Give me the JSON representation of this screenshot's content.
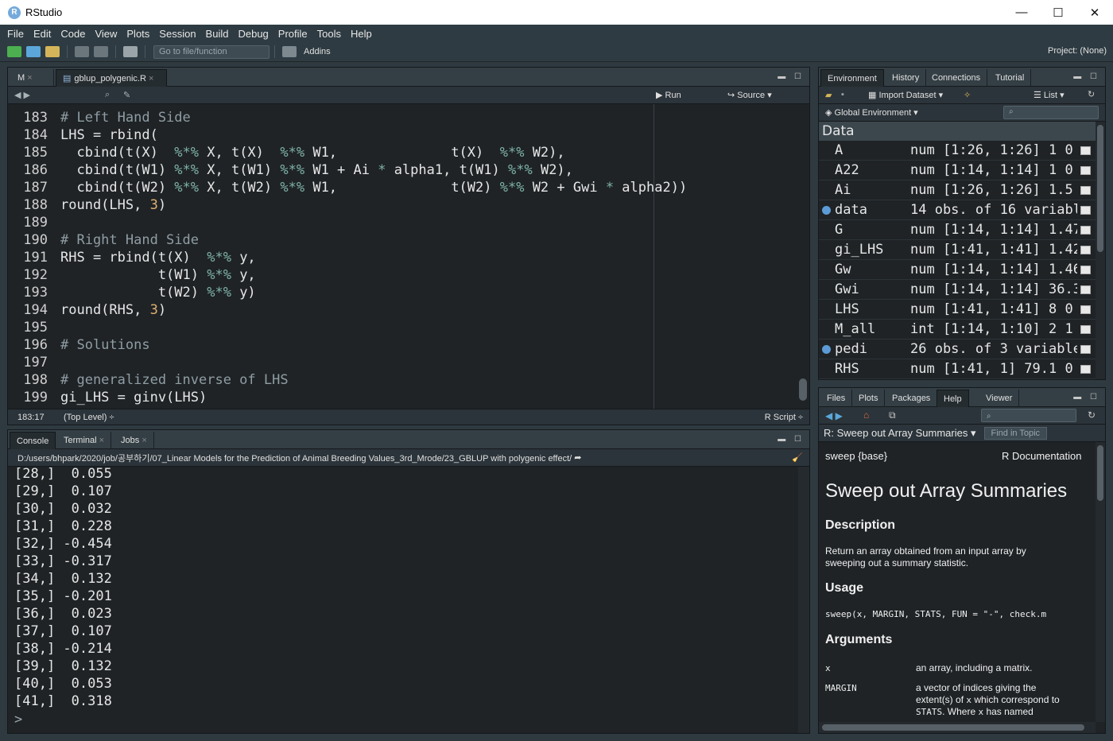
{
  "window": {
    "title": "RStudio",
    "logo": "R",
    "minimize": "—",
    "maximize": "☐",
    "close": "✕"
  },
  "menu": [
    "File",
    "Edit",
    "Code",
    "View",
    "Plots",
    "Session",
    "Build",
    "Debug",
    "Profile",
    "Tools",
    "Help"
  ],
  "toolbar": {
    "goto_placeholder": "Go to file/function",
    "addins": "Addins",
    "project": "Project: (None)"
  },
  "editor": {
    "tabs": [
      {
        "label": "M"
      },
      {
        "label": "gblup_polygenic.R"
      }
    ],
    "run_label": "Run",
    "source_label": "Source",
    "cursor_pos": "183:17",
    "scope": "(Top Level)",
    "filetype": "R Script",
    "lines": [
      {
        "n": "183",
        "segs": [
          {
            "t": "# Left Hand Side",
            "c": "cm"
          }
        ]
      },
      {
        "n": "184",
        "segs": [
          {
            "t": "LHS = rbind(",
            "c": ""
          }
        ]
      },
      {
        "n": "185",
        "segs": [
          {
            "t": "  cbind(t(X)  ",
            "c": ""
          },
          {
            "t": "%*%",
            "c": "op"
          },
          {
            "t": " X, t(X)  ",
            "c": ""
          },
          {
            "t": "%*%",
            "c": "op"
          },
          {
            "t": " W1,              t(X)  ",
            "c": ""
          },
          {
            "t": "%*%",
            "c": "op"
          },
          {
            "t": " W2),",
            "c": ""
          }
        ]
      },
      {
        "n": "186",
        "segs": [
          {
            "t": "  cbind(t(W1) ",
            "c": ""
          },
          {
            "t": "%*%",
            "c": "op"
          },
          {
            "t": " X, t(W1) ",
            "c": ""
          },
          {
            "t": "%*%",
            "c": "op"
          },
          {
            "t": " W1 + Ai ",
            "c": ""
          },
          {
            "t": "*",
            "c": "op"
          },
          {
            "t": " alpha1, t(W1) ",
            "c": ""
          },
          {
            "t": "%*%",
            "c": "op"
          },
          {
            "t": " W2),",
            "c": ""
          }
        ]
      },
      {
        "n": "187",
        "segs": [
          {
            "t": "  cbind(t(W2) ",
            "c": ""
          },
          {
            "t": "%*%",
            "c": "op"
          },
          {
            "t": " X, t(W2) ",
            "c": ""
          },
          {
            "t": "%*%",
            "c": "op"
          },
          {
            "t": " W1,              t(W2) ",
            "c": ""
          },
          {
            "t": "%*%",
            "c": "op"
          },
          {
            "t": " W2 + Gwi ",
            "c": ""
          },
          {
            "t": "*",
            "c": "op"
          },
          {
            "t": " alpha2))",
            "c": ""
          }
        ]
      },
      {
        "n": "188",
        "segs": [
          {
            "t": "round(LHS, ",
            "c": ""
          },
          {
            "t": "3",
            "c": "num"
          },
          {
            "t": ")",
            "c": ""
          }
        ]
      },
      {
        "n": "189",
        "segs": []
      },
      {
        "n": "190",
        "segs": [
          {
            "t": "# Right Hand Side",
            "c": "cm"
          }
        ]
      },
      {
        "n": "191",
        "segs": [
          {
            "t": "RHS = rbind(t(X)  ",
            "c": ""
          },
          {
            "t": "%*%",
            "c": "op"
          },
          {
            "t": " y,",
            "c": ""
          }
        ]
      },
      {
        "n": "192",
        "segs": [
          {
            "t": "            t(W1) ",
            "c": ""
          },
          {
            "t": "%*%",
            "c": "op"
          },
          {
            "t": " y,",
            "c": ""
          }
        ]
      },
      {
        "n": "193",
        "segs": [
          {
            "t": "            t(W2) ",
            "c": ""
          },
          {
            "t": "%*%",
            "c": "op"
          },
          {
            "t": " y)",
            "c": ""
          }
        ]
      },
      {
        "n": "194",
        "segs": [
          {
            "t": "round(RHS, ",
            "c": ""
          },
          {
            "t": "3",
            "c": "num"
          },
          {
            "t": ")",
            "c": ""
          }
        ]
      },
      {
        "n": "195",
        "segs": []
      },
      {
        "n": "196",
        "segs": [
          {
            "t": "# Solutions",
            "c": "cm"
          }
        ]
      },
      {
        "n": "197",
        "segs": []
      },
      {
        "n": "198",
        "segs": [
          {
            "t": "# generalized inverse of LHS",
            "c": "cm"
          }
        ]
      },
      {
        "n": "199",
        "segs": [
          {
            "t": "gi_LHS = ginv(LHS)",
            "c": ""
          }
        ]
      }
    ]
  },
  "console": {
    "tabs": [
      {
        "label": "Console"
      },
      {
        "label": "Terminal"
      },
      {
        "label": "Jobs"
      }
    ],
    "path": "D:/users/bhpark/2020/job/공부하기/07_Linear Models for the Prediction of Animal Breeding Values_3rd_Mrode/23_GBLUP with polygenic effect/",
    "lines": [
      "[28,]  0.055",
      "[29,]  0.107",
      "[30,]  0.032",
      "[31,]  0.228",
      "[32,] -0.454",
      "[33,] -0.317",
      "[34,]  0.132",
      "[35,] -0.201",
      "[36,]  0.023",
      "[37,]  0.107",
      "[38,] -0.214",
      "[39,]  0.132",
      "[40,]  0.053",
      "[41,]  0.318"
    ],
    "prompt": ">"
  },
  "environment": {
    "tabs": [
      {
        "label": "Environment"
      },
      {
        "label": "History"
      },
      {
        "label": "Connections"
      },
      {
        "label": "Tutorial"
      }
    ],
    "import_label": "Import Dataset",
    "list_label": "List",
    "scope_label": "Global Environment",
    "section": "Data",
    "rows": [
      {
        "name": "A",
        "value": "num [1:26, 1:26] 1 0 ...",
        "expand": false
      },
      {
        "name": "A22",
        "value": "num [1:14, 1:14] 1 0 ...",
        "expand": false
      },
      {
        "name": "Ai",
        "value": "num [1:26, 1:26] 1.5 ...",
        "expand": false
      },
      {
        "name": "data",
        "value": "14 obs. of 16 variabl…",
        "expand": true
      },
      {
        "name": "G",
        "value": "num [1:14, 1:14] 1.47…",
        "expand": false
      },
      {
        "name": "gi_LHS",
        "value": "num [1:41, 1:41] 1.42…",
        "expand": false
      },
      {
        "name": "Gw",
        "value": "num [1:14, 1:14] 1.46…",
        "expand": false
      },
      {
        "name": "Gwi",
        "value": "num [1:14, 1:14] 36.3…",
        "expand": false
      },
      {
        "name": "LHS",
        "value": "num [1:41, 1:41] 8 0 ...",
        "expand": false
      },
      {
        "name": "M_all",
        "value": "int [1:14, 1:10] 2 1 ...",
        "expand": false
      },
      {
        "name": "pedi",
        "value": "26 obs. of 3 variables",
        "expand": true
      },
      {
        "name": "RHS",
        "value": "num [1:41, 1] 79.1 0 ...",
        "expand": false
      }
    ]
  },
  "help": {
    "tabs": [
      {
        "label": "Files"
      },
      {
        "label": "Plots"
      },
      {
        "label": "Packages"
      },
      {
        "label": "Help"
      },
      {
        "label": "Viewer"
      }
    ],
    "topic_label": "R: Sweep out Array Summaries",
    "find_placeholder": "Find in Topic",
    "pkg": "sweep {base}",
    "doc": "R Documentation",
    "title": "Sweep out Array Summaries",
    "desc_head": "Description",
    "desc1": "Return an array obtained from an input array by",
    "desc2": "sweeping out a summary statistic.",
    "usage_head": "Usage",
    "usage": "sweep(x, MARGIN, STATS, FUN = \"-\", check.m",
    "args_head": "Arguments",
    "arg1_name": "x",
    "arg1_desc": "an array, including a matrix.",
    "arg2_name": "MARGIN",
    "arg2_desc1": "a vector of indices giving the",
    "arg2_desc2_a": "extent(s) of ",
    "arg2_desc2_b": "x",
    "arg2_desc2_c": " which correspond to",
    "arg2_desc3_a": "STATS",
    "arg2_desc3_b": ". Where ",
    "arg2_desc3_c": "x",
    "arg2_desc3_d": " has named"
  }
}
